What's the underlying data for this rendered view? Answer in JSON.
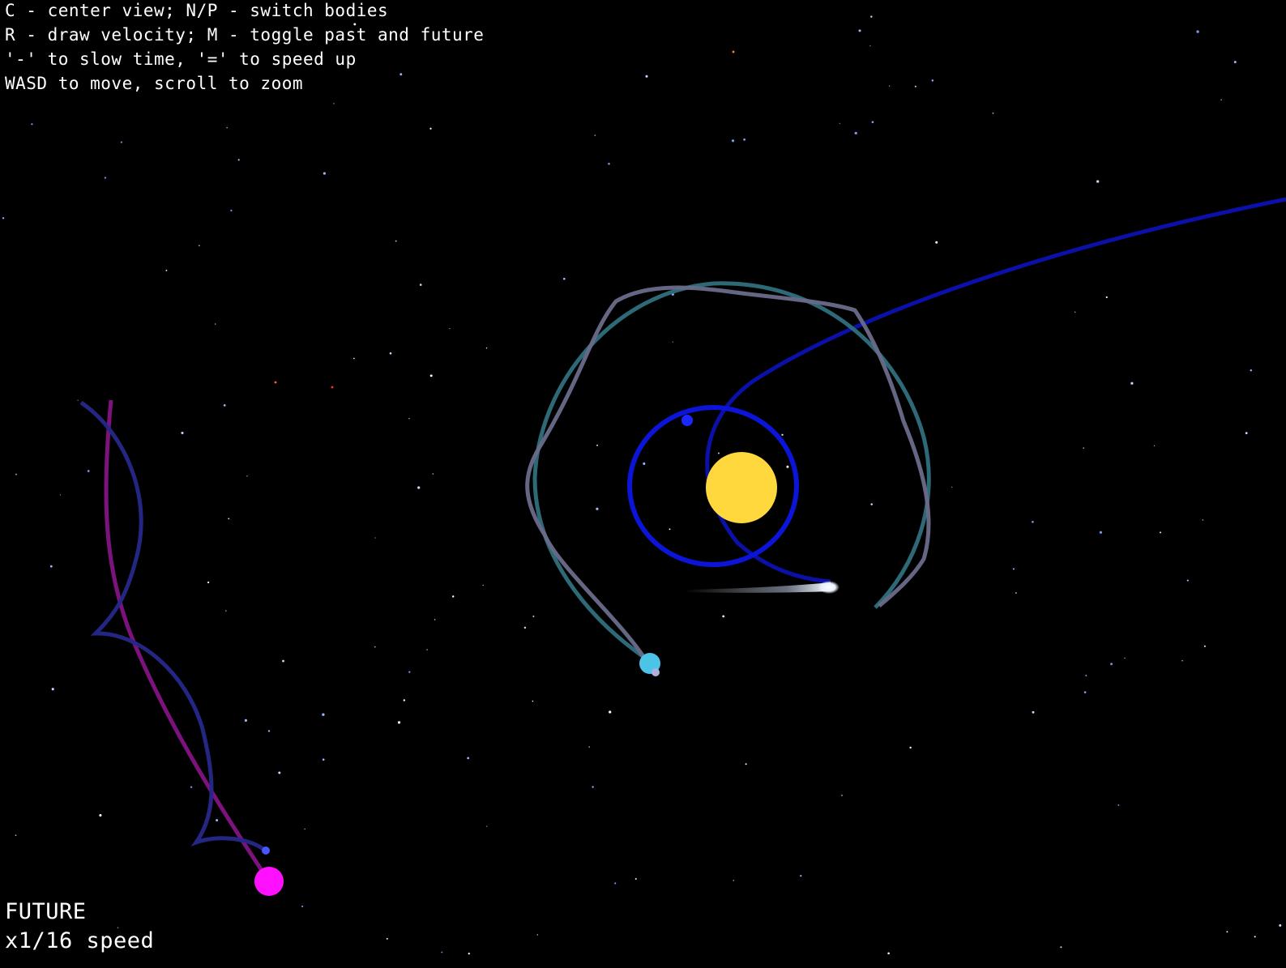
{
  "help": {
    "line1": "C - center view; N/P - switch bodies",
    "line2": "R - draw velocity; M - toggle past and future",
    "line3": "'-' to slow time, '=' to speed up",
    "line4": "WASD to move, scroll to zoom"
  },
  "status": {
    "mode": "FUTURE",
    "speed": "x1/16 speed"
  },
  "colors": {
    "background": "#000000",
    "sun": "#ffd83d",
    "inner_orbit": "#0c14d8",
    "comet_path": "#0a10a8",
    "teal_orbit": "#2f6f7c",
    "grey_orbit": "#6a6c8a",
    "cyan_planet": "#4cc4e8",
    "magenta_body": "#ff10ff",
    "magenta_trail": "#8a148a",
    "navy_trail": "#26288a",
    "comet": "#ffffff"
  }
}
